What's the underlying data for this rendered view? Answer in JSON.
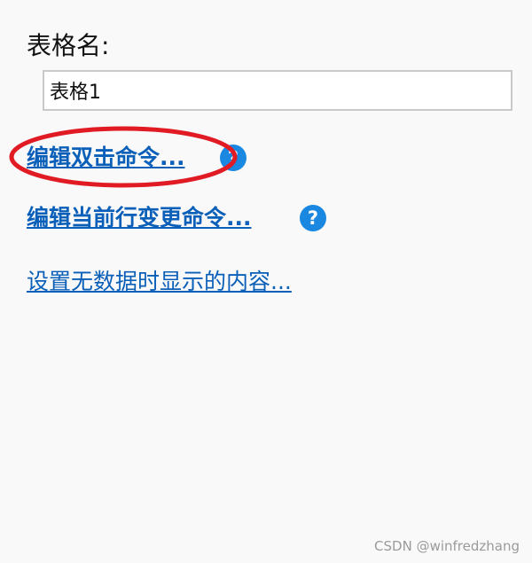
{
  "table_name": {
    "label": "表格名:",
    "value": "表格1"
  },
  "links": {
    "edit_double_click": "编辑双击命令...",
    "edit_row_change": "编辑当前行变更命令...",
    "empty_content": "设置无数据时显示的内容..."
  },
  "help_icon_glyph": "?",
  "watermark": "CSDN @winfredzhang",
  "colors": {
    "link": "#0a5fb8",
    "help_icon": "#1a88e0",
    "highlight_ellipse": "#e01b24",
    "background": "#f9f9f9"
  }
}
